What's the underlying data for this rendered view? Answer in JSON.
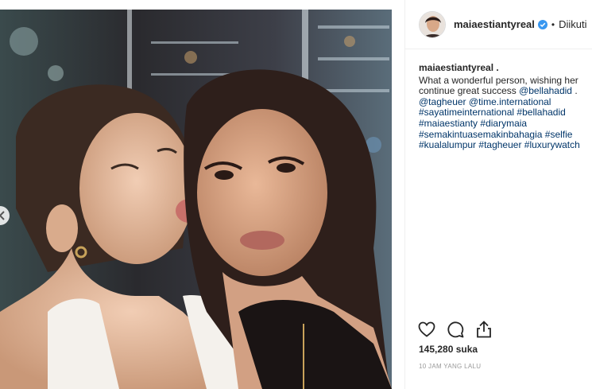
{
  "post": {
    "photo_alt": "Selfie of two women",
    "prev_icon": "chevron-left-icon"
  },
  "header": {
    "username": "maiaestiantyreal",
    "verified_icon": "verified-badge-icon",
    "separator": "•",
    "follow_status": "Diikuti"
  },
  "caption": {
    "username": "maiaestiantyreal .",
    "parts": [
      {
        "text": "What a wonderful person, wishing her continue great success ",
        "tag": false
      },
      {
        "text": "@bellahadid",
        "tag": true
      },
      {
        "text": " . ",
        "tag": false
      },
      {
        "text": "@tagheuer",
        "tag": true
      },
      {
        "text": " ",
        "tag": false
      },
      {
        "text": "@time.international",
        "tag": true
      },
      {
        "text": " ",
        "tag": false
      },
      {
        "text": "#sayatimeinternational",
        "tag": true
      },
      {
        "text": " ",
        "tag": false
      },
      {
        "text": "#bellahadid",
        "tag": true
      },
      {
        "text": " ",
        "tag": false
      },
      {
        "text": "#maiaestianty",
        "tag": true
      },
      {
        "text": " ",
        "tag": false
      },
      {
        "text": "#diarymaia",
        "tag": true
      },
      {
        "text": " ",
        "tag": false
      },
      {
        "text": "#semakintuasemakinbahagia",
        "tag": true
      },
      {
        "text": " ",
        "tag": false
      },
      {
        "text": "#selfie",
        "tag": true
      },
      {
        "text": " ",
        "tag": false
      },
      {
        "text": "#kualalumpur",
        "tag": true
      },
      {
        "text": " ",
        "tag": false
      },
      {
        "text": "#tagheuer",
        "tag": true
      },
      {
        "text": " ",
        "tag": false
      },
      {
        "text": "#luxurywatch",
        "tag": true
      }
    ]
  },
  "actions": {
    "like_icon": "heart-icon",
    "comment_icon": "comment-icon",
    "share_icon": "share-icon"
  },
  "likes": "145,280 suka",
  "timestamp": "10 JAM YANG LALU",
  "colors": {
    "link": "#003569",
    "verified": "#3897f0",
    "text": "#262626",
    "muted": "#999999",
    "border": "#efefef"
  }
}
